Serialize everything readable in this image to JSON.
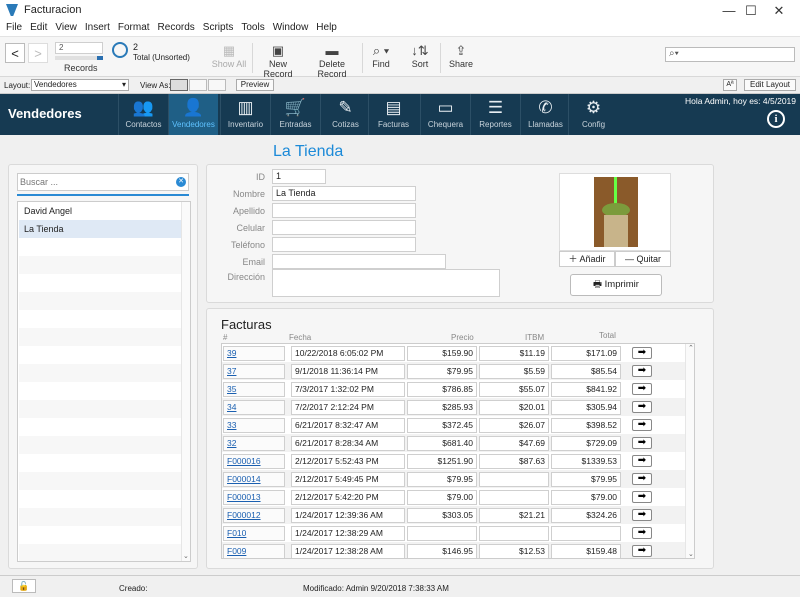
{
  "window": {
    "title": "Facturacion"
  },
  "menu": [
    "File",
    "Edit",
    "View",
    "Insert",
    "Format",
    "Records",
    "Scripts",
    "Tools",
    "Window",
    "Help"
  ],
  "toolbar": {
    "record_value": "2",
    "records_label": "Records",
    "total_count": "2",
    "total_label": "Total (Unsorted)",
    "show_all": "Show All",
    "new_record": "New Record",
    "delete_record": "Delete Record",
    "find": "Find",
    "sort": "Sort",
    "share": "Share"
  },
  "layoutbar": {
    "layout_label": "Layout:",
    "layout_value": "Vendedores",
    "view_as": "View As:",
    "preview": "Preview",
    "aa": "Aª",
    "edit_layout": "Edit Layout"
  },
  "navbar": {
    "brand": "Vendedores",
    "greeting": "Hola Admin, hoy es: 4/5/2019",
    "tabs": [
      {
        "label": "Contactos",
        "icon": "people-icon",
        "glyph": "👥"
      },
      {
        "label": "Vendedores",
        "icon": "person-icon",
        "glyph": "👤"
      },
      {
        "label": "Inventario",
        "icon": "barcode-icon",
        "glyph": "▥"
      },
      {
        "label": "Entradas",
        "icon": "cart-icon",
        "glyph": "🛒"
      },
      {
        "label": "Cotizas",
        "icon": "edit-icon",
        "glyph": "✎"
      },
      {
        "label": "Facturas",
        "icon": "invoice-icon",
        "glyph": "▤"
      },
      {
        "label": "Chequera",
        "icon": "checkbook-icon",
        "glyph": "▭"
      },
      {
        "label": "Reportes",
        "icon": "list-icon",
        "glyph": "☰"
      },
      {
        "label": "Llamadas",
        "icon": "phone-icon",
        "glyph": "✆"
      },
      {
        "label": "Config",
        "icon": "gear-icon",
        "glyph": "⚙"
      }
    ]
  },
  "sidebar": {
    "search_placeholder": "Buscar ...",
    "items": [
      "David Angel",
      "La Tienda"
    ]
  },
  "record": {
    "title": "La Tienda",
    "fields": [
      {
        "label": "ID",
        "value": "1"
      },
      {
        "label": "Nombre",
        "value": "La Tienda"
      },
      {
        "label": "Apellido",
        "value": ""
      },
      {
        "label": "Celular",
        "value": ""
      },
      {
        "label": "Teléfono",
        "value": ""
      },
      {
        "label": "Email",
        "value": ""
      },
      {
        "label": "Dirección",
        "value": ""
      }
    ],
    "add_label": "Añadir",
    "remove_label": "Quitar",
    "print_label": "Imprimir"
  },
  "facturas": {
    "title": "Facturas",
    "headers": [
      "#",
      "Fecha",
      "Precio",
      "ITBM",
      "Total"
    ],
    "rows": [
      {
        "id": "39",
        "fecha": "10/22/2018 6:05:02 PM",
        "precio": "$159.90",
        "itbm": "$11.19",
        "total": "$171.09"
      },
      {
        "id": "37",
        "fecha": "9/1/2018 11:36:14 PM",
        "precio": "$79.95",
        "itbm": "$5.59",
        "total": "$85.54"
      },
      {
        "id": "35",
        "fecha": "7/3/2017 1:32:02 PM",
        "precio": "$786.85",
        "itbm": "$55.07",
        "total": "$841.92"
      },
      {
        "id": "34",
        "fecha": "7/2/2017 2:12:24 PM",
        "precio": "$285.93",
        "itbm": "$20.01",
        "total": "$305.94"
      },
      {
        "id": "33",
        "fecha": "6/21/2017 8:32:47 AM",
        "precio": "$372.45",
        "itbm": "$26.07",
        "total": "$398.52"
      },
      {
        "id": "32",
        "fecha": "6/21/2017 8:28:34 AM",
        "precio": "$681.40",
        "itbm": "$47.69",
        "total": "$729.09"
      },
      {
        "id": "F000016",
        "fecha": "2/12/2017 5:52:43 PM",
        "precio": "$1251.90",
        "itbm": "$87.63",
        "total": "$1339.53"
      },
      {
        "id": "F000014",
        "fecha": "2/12/2017 5:49:45 PM",
        "precio": "$79.95",
        "itbm": "",
        "total": "$79.95"
      },
      {
        "id": "F000013",
        "fecha": "2/12/2017 5:42:20 PM",
        "precio": "$79.00",
        "itbm": "",
        "total": "$79.00"
      },
      {
        "id": "F000012",
        "fecha": "1/24/2017 12:39:36 AM",
        "precio": "$303.05",
        "itbm": "$21.21",
        "total": "$324.26"
      },
      {
        "id": "F010",
        "fecha": "1/24/2017 12:38:29 AM",
        "precio": "",
        "itbm": "",
        "total": ""
      },
      {
        "id": "F009",
        "fecha": "1/24/2017 12:38:28 AM",
        "precio": "$146.95",
        "itbm": "$12.53",
        "total": "$159.48"
      }
    ]
  },
  "status": {
    "created": "Creado:",
    "modified": "Modificado: Admin  9/20/2018 7:38:33 AM"
  }
}
